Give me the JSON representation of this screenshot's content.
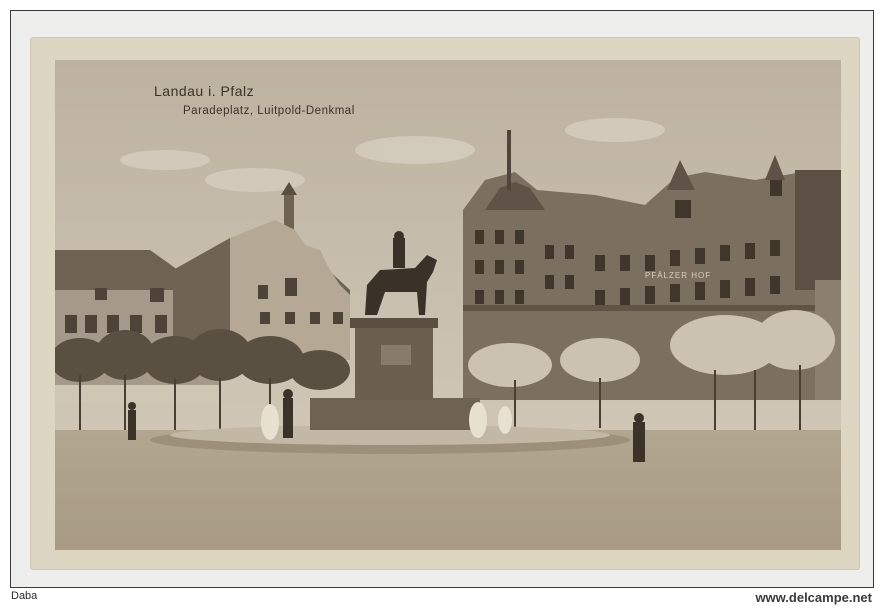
{
  "postcard": {
    "caption_line_1": "Landau i. Pfalz",
    "caption_line_2": "Paradeplatz, Luitpold-Denkmal",
    "building_sign": "PFÄLZER HOF"
  },
  "footer": {
    "seller": "Daba",
    "site": "www.delcampe.net"
  },
  "colors": {
    "card": "#ddd6c3",
    "sepia_dark": "#4a3f33",
    "sky": "#c9c0af",
    "ground": "#b8ab96"
  }
}
